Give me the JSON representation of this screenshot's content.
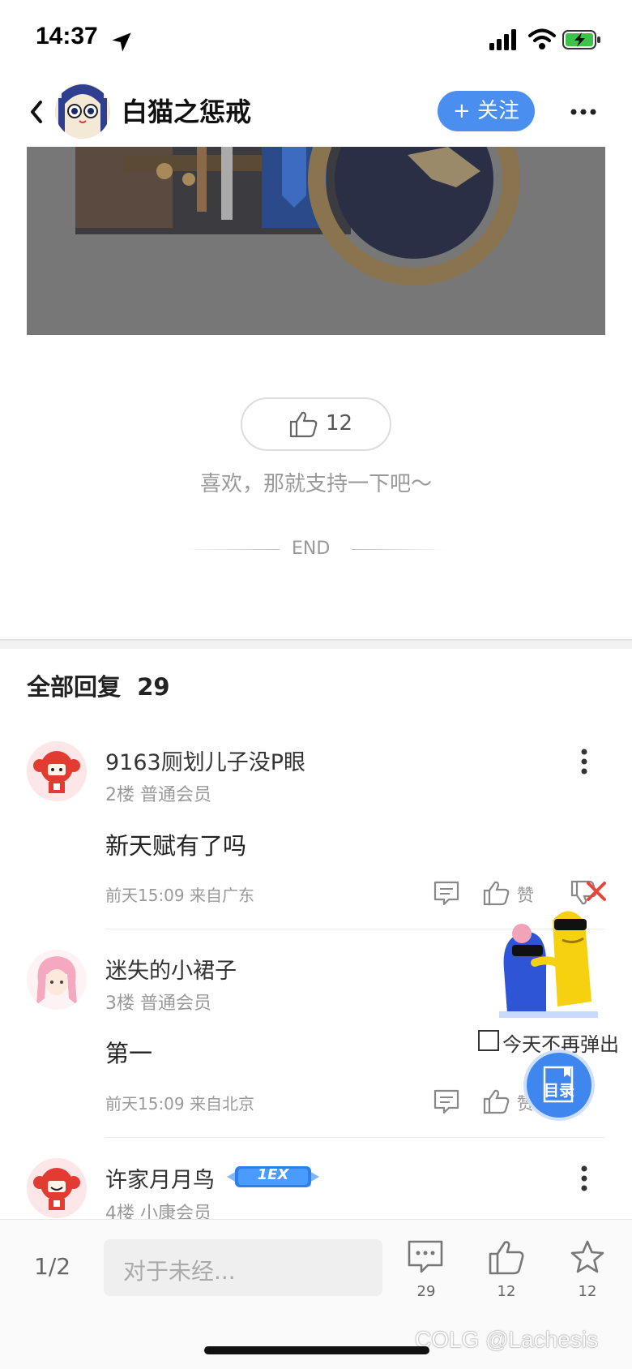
{
  "status_bar": {
    "time": "14:37"
  },
  "header": {
    "title": "白猫之惩戒",
    "follow_label": "+ 关注"
  },
  "post": {
    "like_count": "12",
    "like_hint": "喜欢，那就支持一下吧～",
    "end_label": "END"
  },
  "replies": {
    "section_label": "全部回复",
    "count": "29",
    "items": [
      {
        "author": "9163厕划儿子没P眼",
        "floor": "2楼",
        "rank": "普通会员",
        "text": "新天赋有了吗",
        "time": "前天15:09 来自广东",
        "like_label": "赞"
      },
      {
        "author": "迷失的小裙子",
        "floor": "3楼",
        "rank": "普通会员",
        "text": "第一",
        "time": "前天15:09 来自北京",
        "like_label": "赞"
      },
      {
        "author": "许家月月鸟",
        "floor": "4楼",
        "rank": "小康会员",
        "badge": "1EX"
      }
    ]
  },
  "popup": {
    "checkbox_label": "今天不再弹出"
  },
  "toc": {
    "label": "目录"
  },
  "bottom_bar": {
    "page_indicator": "1/2",
    "input_placeholder": "对于未经...",
    "comment_count": "29",
    "like_count": "12",
    "fav_count": "12"
  },
  "watermark": "COLG @Lachesis"
}
